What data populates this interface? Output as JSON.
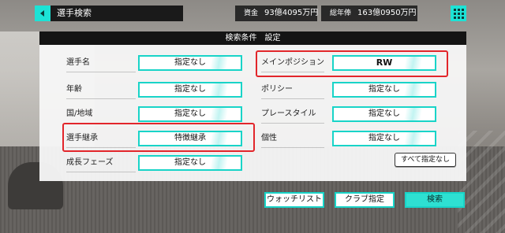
{
  "header": {
    "title": "選手検索",
    "funds_label": "資金",
    "funds_value": "93億4095万円",
    "salary_label": "総年俸",
    "salary_value": "163億0950万円"
  },
  "panel": {
    "title": "検索条件　設定",
    "left_fields": [
      {
        "label": "選手名",
        "value": "指定なし"
      },
      {
        "label": "年齢",
        "value": "指定なし"
      },
      {
        "label": "国/地域",
        "value": "指定なし"
      },
      {
        "label": "選手継承",
        "value": "特徴継承"
      },
      {
        "label": "成長フェーズ",
        "value": "指定なし"
      }
    ],
    "right_fields": [
      {
        "label": "メインポジション",
        "value": "RW"
      },
      {
        "label": "ポリシー",
        "value": "指定なし"
      },
      {
        "label": "プレースタイル",
        "value": "指定なし"
      },
      {
        "label": "個性",
        "value": "指定なし"
      }
    ],
    "reset_all_label": "すべて指定なし"
  },
  "footer": {
    "watchlist_label": "ウォッチリスト",
    "club_label": "クラブ指定",
    "search_label": "検索"
  },
  "colors": {
    "accent": "#1ce3d6",
    "highlight": "#e2262b",
    "header_bg": "#141414"
  },
  "icons": {
    "back": "back-arrow-icon",
    "menu": "grid-menu-icon",
    "money": "money-icon"
  }
}
